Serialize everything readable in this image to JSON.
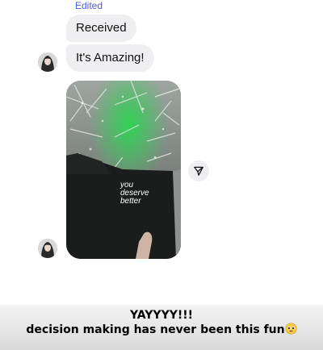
{
  "chat": {
    "edited_label": "Edited",
    "messages": [
      {
        "text": "Received"
      },
      {
        "text": "It's Amazing!"
      }
    ],
    "photo_message": {
      "book_text": [
        "you",
        "deserve",
        "better"
      ]
    },
    "icons": {
      "avatar": "avatar-icon",
      "share": "send-icon"
    }
  },
  "story": {
    "line1": "YAYYYY!!!",
    "line2": "decision making has never been this fun",
    "emoji": "pleading-face-icon"
  },
  "colors": {
    "bubble": "#efeff1",
    "edited": "#4a5bd6",
    "tree_green": "#2fa84f"
  }
}
